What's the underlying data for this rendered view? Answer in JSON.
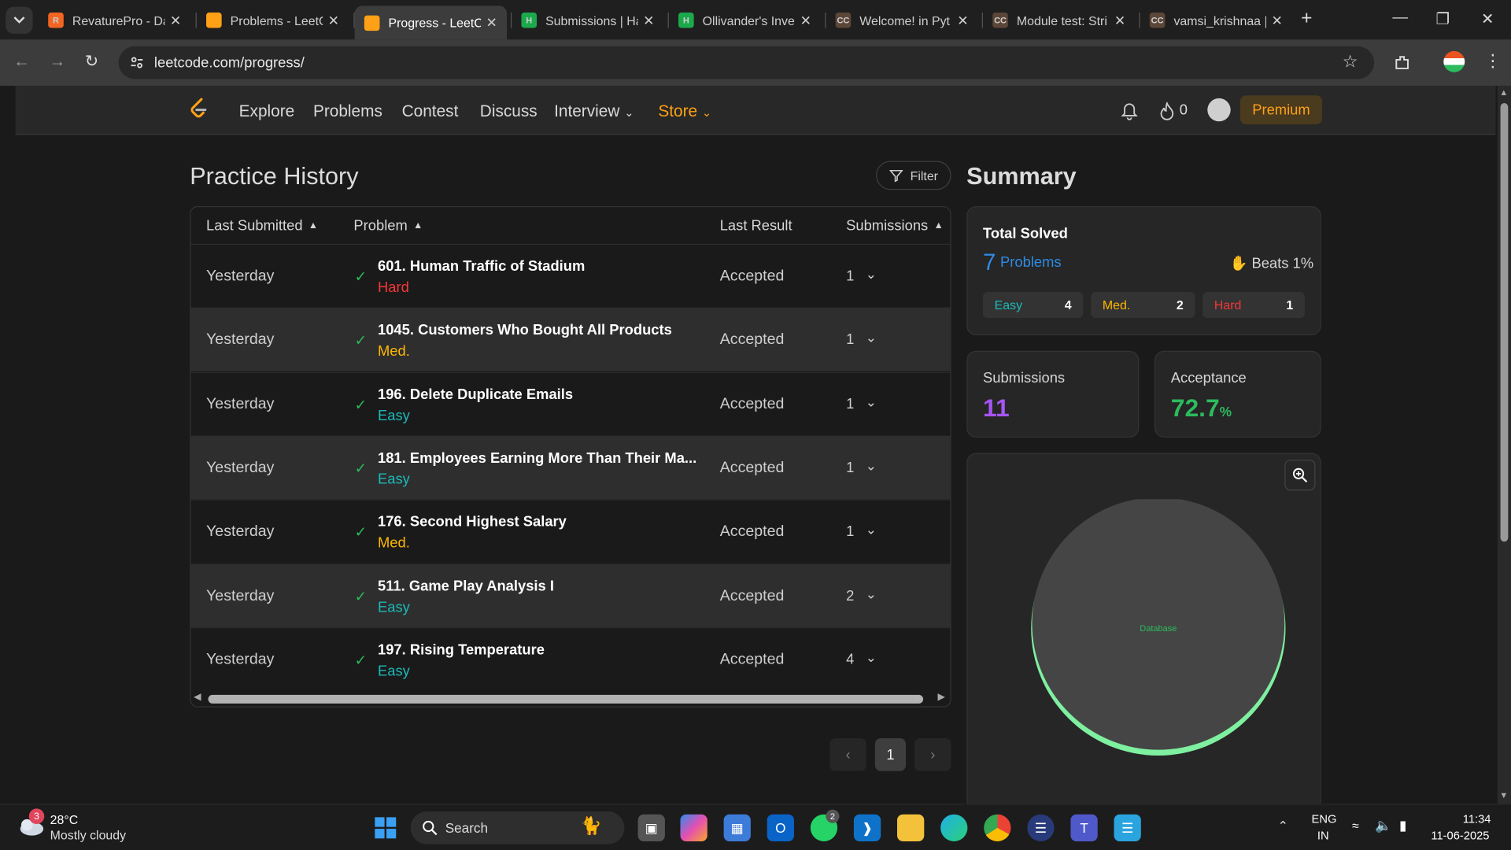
{
  "browser": {
    "tabs": [
      {
        "title": "RevaturePro - Da",
        "icon": "revature-icon",
        "fav": "R",
        "color": "#f26522",
        "active": false
      },
      {
        "title": "Problems - LeetC",
        "icon": "leetcode-icon",
        "fav": "",
        "color": "#ffa116",
        "active": false
      },
      {
        "title": "Progress - LeetC",
        "icon": "leetcode-icon",
        "fav": "",
        "color": "#ffa116",
        "active": true
      },
      {
        "title": "Submissions | Ha",
        "icon": "hackerrank-icon",
        "fav": "H",
        "color": "#1ba94c",
        "active": false
      },
      {
        "title": "Ollivander's Inve",
        "icon": "hackerrank-icon",
        "fav": "H",
        "color": "#1ba94c",
        "active": false
      },
      {
        "title": "Welcome! in Pyt",
        "icon": "codechef-icon",
        "fav": "CC",
        "color": "#5b4638",
        "active": false
      },
      {
        "title": "Module test: Stri",
        "icon": "codechef-icon",
        "fav": "CC",
        "color": "#5b4638",
        "active": false
      },
      {
        "title": "vamsi_krishnaa |",
        "icon": "codechef-icon",
        "fav": "CC",
        "color": "#5b4638",
        "active": false
      }
    ],
    "new_tab": "+",
    "url": "leetcode.com/progress/"
  },
  "nav": {
    "links": [
      "Explore",
      "Problems",
      "Contest",
      "Discuss",
      "Interview"
    ],
    "store": "Store",
    "streak": "0",
    "premium": "Premium"
  },
  "history": {
    "title": "Practice History",
    "filter": "Filter",
    "headers": {
      "last_submitted": "Last Submitted",
      "problem": "Problem",
      "last_result": "Last Result",
      "submissions": "Submissions"
    },
    "rows": [
      {
        "when": "Yesterday",
        "title": "601. Human Traffic of Stadium",
        "difficulty": "Hard",
        "result": "Accepted",
        "subs": "1"
      },
      {
        "when": "Yesterday",
        "title": "1045. Customers Who Bought All Products",
        "difficulty": "Med.",
        "result": "Accepted",
        "subs": "1"
      },
      {
        "when": "Yesterday",
        "title": "196. Delete Duplicate Emails",
        "difficulty": "Easy",
        "result": "Accepted",
        "subs": "1"
      },
      {
        "when": "Yesterday",
        "title": "181. Employees Earning More Than Their Ma...",
        "difficulty": "Easy",
        "result": "Accepted",
        "subs": "1"
      },
      {
        "when": "Yesterday",
        "title": "176. Second Highest Salary",
        "difficulty": "Med.",
        "result": "Accepted",
        "subs": "1"
      },
      {
        "when": "Yesterday",
        "title": "511. Game Play Analysis I",
        "difficulty": "Easy",
        "result": "Accepted",
        "subs": "2"
      },
      {
        "when": "Yesterday",
        "title": "197. Rising Temperature",
        "difficulty": "Easy",
        "result": "Accepted",
        "subs": "4"
      }
    ],
    "page": "1"
  },
  "summary": {
    "title": "Summary",
    "total_solved_label": "Total Solved",
    "solved_count": "7",
    "solved_unit": "Problems",
    "beats": "Beats 1%",
    "easy_label": "Easy",
    "easy_count": "4",
    "med_label": "Med.",
    "med_count": "2",
    "hard_label": "Hard",
    "hard_count": "1",
    "submissions_label": "Submissions",
    "submissions_value": "11",
    "acceptance_label": "Acceptance",
    "acceptance_value": "72.7",
    "acceptance_unit": "%",
    "pie_label": "Database"
  },
  "colors": {
    "easy": "#1cbaba",
    "medium": "#ffb700",
    "hard": "#f63737",
    "accent": "#ffa116",
    "link": "#2f8be5",
    "purple": "#a855f7",
    "green": "#2cbb5d"
  },
  "taskbar": {
    "weather_temp": "28°C",
    "weather_desc": "Mostly cloudy",
    "weather_badge": "3",
    "search": "Search",
    "whatsapp_badge": "2",
    "lang": "ENG",
    "region": "IN",
    "time": "11:34",
    "date": "11-06-2025"
  }
}
